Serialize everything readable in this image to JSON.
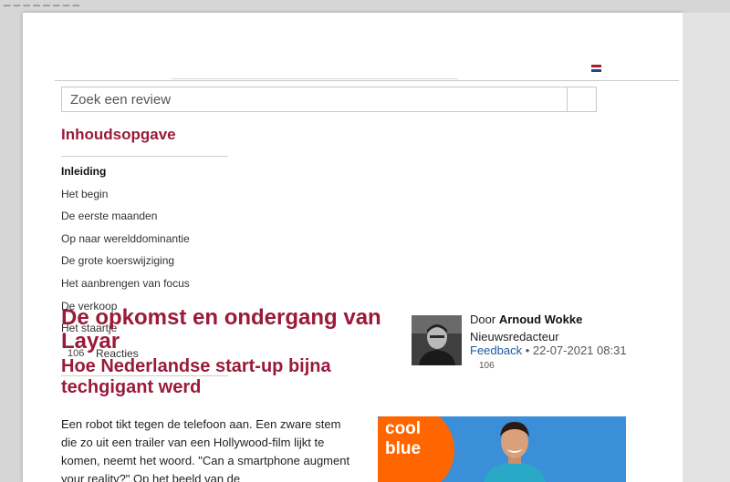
{
  "header": {
    "flag_colors": [
      "#ae1c28",
      "#ffffff",
      "#21468b"
    ]
  },
  "search": {
    "placeholder": "Zoek een review"
  },
  "toc": {
    "title": "Inhoudsopgave",
    "items": [
      {
        "label": "Inleiding",
        "active": true
      },
      {
        "label": "Het begin"
      },
      {
        "label": "De eerste maanden"
      },
      {
        "label": "Op naar werelddominantie"
      },
      {
        "label": "De grote koerswijziging"
      },
      {
        "label": "Het aanbrengen van focus"
      },
      {
        "label": "De verkoop"
      },
      {
        "label": "Het staartje"
      }
    ]
  },
  "reactions": {
    "count": "106",
    "label": "Reacties"
  },
  "article": {
    "title": "De opkomst en ondergang van Layar",
    "subtitle": "Hoe Nederlandse start-up bijna techgigant werd",
    "body": "Een robot tikt tegen de telefoon aan. Een zware stem die zo uit een trailer van een Hollywood-film lijkt te komen, neemt het woord. \"Can a smartphone augment your reality?\" Op het beeld van de"
  },
  "author": {
    "by_prefix": "Door",
    "name": "Arnoud Wokke",
    "role": "Nieuwsredacteur",
    "feedback_label": "Feedback",
    "separator": "•",
    "datetime": "22-07-2021 08:31",
    "reaction_count": "106"
  },
  "ad": {
    "brand_line1": "cool",
    "brand_line2": "blue",
    "colors": {
      "background": "#3a8fd8",
      "logo": "#ff6600"
    }
  },
  "colors": {
    "accent": "#9a1a3a",
    "link": "#1c5a9c"
  }
}
